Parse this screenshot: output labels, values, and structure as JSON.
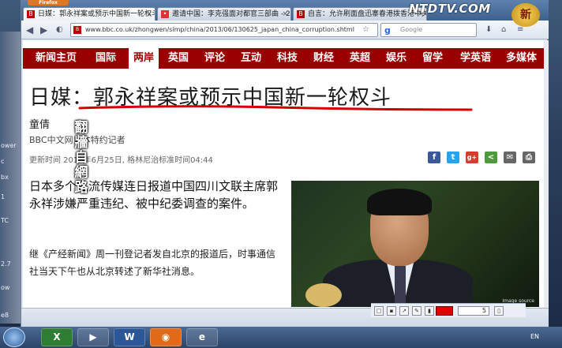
{
  "watermark": {
    "logo": "NTDTV.COM",
    "badge": "新"
  },
  "browser": {
    "menu_button": "Firefox",
    "tabs": [
      {
        "label": "日媒：郭永祥案或预示中国新一轮权斗",
        "active": true
      },
      {
        "label": "邀请中国：李克强面对都官三部曲 - 2...",
        "active": false
      },
      {
        "label": "自言：允许刷面盘迅寨春港拨香港中关...",
        "active": false
      }
    ],
    "url": "www.bbc.co.uk/zhongwen/simp/china/2013/06/130625_japan_china_corruption.shtml",
    "search_placeholder": "Google"
  },
  "bbc_nav": [
    "新闻主页",
    "国际",
    "两岸",
    "英国",
    "评论",
    "互动",
    "科技",
    "财经",
    "英超",
    "娱乐",
    "留学",
    "学英语",
    "多媒体"
  ],
  "bbc_nav_active": "两岸",
  "article": {
    "headline": "日媒：郭永祥案或预示中国新一轮权斗",
    "author": "童倩",
    "role": "BBC中文网日本特约记者",
    "date": "更新时间 2013年6月25日, 格林尼治标准时间04:44",
    "para1": "日本多个主流传媒连日报道中国四川文联主席郭永祥涉嫌严重违纪、被中纪委调查的案件。",
    "para2": "继《产经新闻》周一刊登记者发自北京的报道后，时事通信社当天下午也从北京转述了新华社消息。",
    "photo_caption": "Image source"
  },
  "stamp": [
    "翻",
    "牆",
    "自",
    "網",
    "路"
  ],
  "share_icons": [
    {
      "name": "facebook-icon",
      "glyph": "f",
      "color": "#3b5998"
    },
    {
      "name": "twitter-icon",
      "glyph": "t",
      "color": "#2aa3ef"
    },
    {
      "name": "googleplus-icon",
      "glyph": "g+",
      "color": "#d23f2f"
    },
    {
      "name": "share-icon",
      "glyph": "<",
      "color": "#4c9a3c"
    },
    {
      "name": "email-icon",
      "glyph": "✉",
      "color": "#666666"
    },
    {
      "name": "print-icon",
      "glyph": "⎙",
      "color": "#666666"
    }
  ],
  "editbar": {
    "size_value": "5"
  },
  "desktop_labels": [
    "ower",
    "c",
    "bx",
    "1",
    "TC",
    "2.7",
    "ow",
    "e8"
  ],
  "tray": {
    "lang": "EN"
  }
}
